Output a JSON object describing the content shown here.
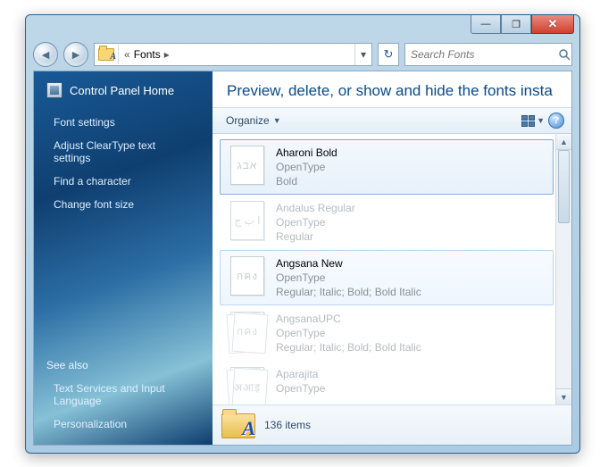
{
  "titlebar": {
    "minimize": "—",
    "maximize": "❐",
    "close_label": "✕"
  },
  "nav": {
    "back": "◄",
    "forward": "►"
  },
  "address": {
    "prefix": "«",
    "segment": "Fonts",
    "sep": "▸",
    "dropdown": "▾",
    "refresh": "↻"
  },
  "search": {
    "placeholder": "Search Fonts",
    "icon": "🔍"
  },
  "sidebar": {
    "home": "Control Panel Home",
    "links": [
      "Font settings",
      "Adjust ClearType text settings",
      "Find a character",
      "Change font size"
    ],
    "see_also_title": "See also",
    "see_also": [
      "Text Services and Input Language",
      "Personalization"
    ]
  },
  "main": {
    "heading": "Preview, delete, or show and hide the fonts insta",
    "organize": "Organize",
    "items_count": "136 items"
  },
  "fonts": [
    {
      "name": "Aharoni Bold",
      "type": "OpenType",
      "style": "Bold",
      "sample": "אבג",
      "stack": false,
      "state": "sel"
    },
    {
      "name": "Andalus Regular",
      "type": "OpenType",
      "style": "Regular",
      "sample": "ا ب ج",
      "stack": false,
      "state": "cut"
    },
    {
      "name": "Angsana New",
      "type": "OpenType",
      "style": "Regular; Italic; Bold; Bold Italic",
      "sample": "กคง",
      "stack": true,
      "state": "hov"
    },
    {
      "name": "AngsanaUPC",
      "type": "OpenType",
      "style": "Regular; Italic; Bold; Bold Italic",
      "sample": "กคง",
      "stack": true,
      "state": "cut"
    },
    {
      "name": "Aparajita",
      "type": "OpenType",
      "style": "",
      "sample": "अआइ",
      "stack": true,
      "state": "cut"
    }
  ]
}
